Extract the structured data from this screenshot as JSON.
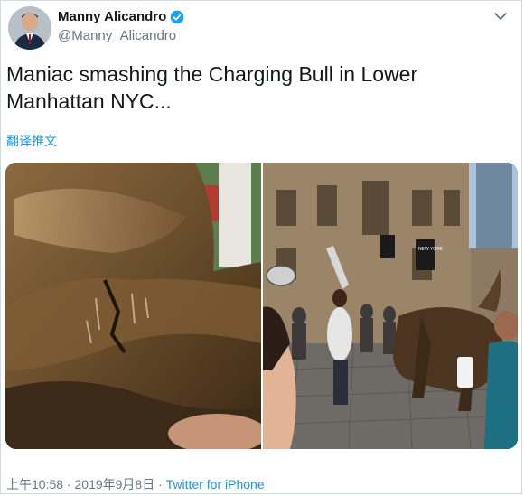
{
  "author": {
    "name": "Manny Alicandro",
    "handle": "@Manny_Alicandro"
  },
  "tweet": {
    "text": "Maniac smashing the Charging Bull in Lower Manhattan NYC...",
    "translate_label": "翻译推文"
  },
  "media": {
    "left_photo": "close-up of dented bronze bull",
    "right_photo": "man swinging object at Charging Bull statue",
    "sign_text": "NEW YORK"
  },
  "meta": {
    "time": "上午10:58",
    "separator": " · ",
    "date": "2019年9月8日",
    "source": "Twitter for iPhone"
  },
  "colors": {
    "accent": "#1b95e0",
    "secondary_text": "#657786",
    "border": "#cfd9de"
  }
}
